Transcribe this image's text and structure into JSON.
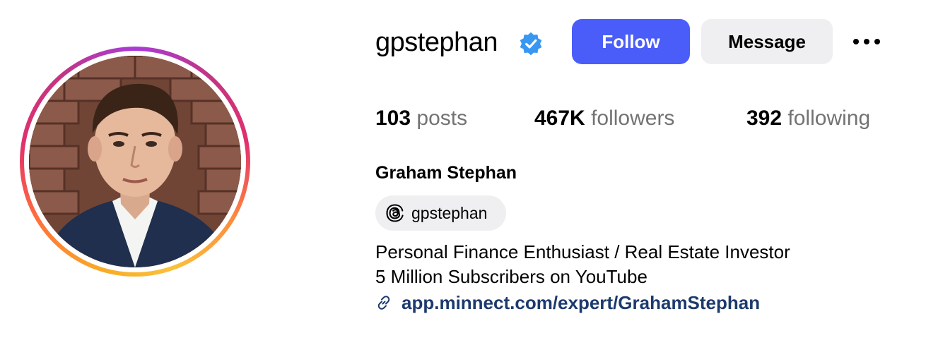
{
  "profile": {
    "username": "gpstephan",
    "verified": true,
    "full_name": "Graham Stephan",
    "avatar_description": "profile-photo"
  },
  "actions": {
    "follow_label": "Follow",
    "message_label": "Message",
    "more_icon": "ellipsis-icon"
  },
  "stats": {
    "posts": {
      "count": "103",
      "label": "posts"
    },
    "followers": {
      "count": "467K",
      "label": "followers"
    },
    "following": {
      "count": "392",
      "label": "following"
    }
  },
  "threads": {
    "icon": "threads-icon",
    "handle": "gpstephan"
  },
  "bio": {
    "lines": [
      "Personal Finance Enthusiast / Real Estate Investor",
      "5 Million Subscribers on YouTube"
    ],
    "link_icon": "link-icon",
    "link": "app.minnect.com/expert/GrahamStephan"
  },
  "colors": {
    "follow_button": "#4a5df9",
    "secondary_button": "#efeff1",
    "verified_badge": "#3897f0",
    "link_text": "#1d3a6e",
    "muted_text": "#737373"
  }
}
